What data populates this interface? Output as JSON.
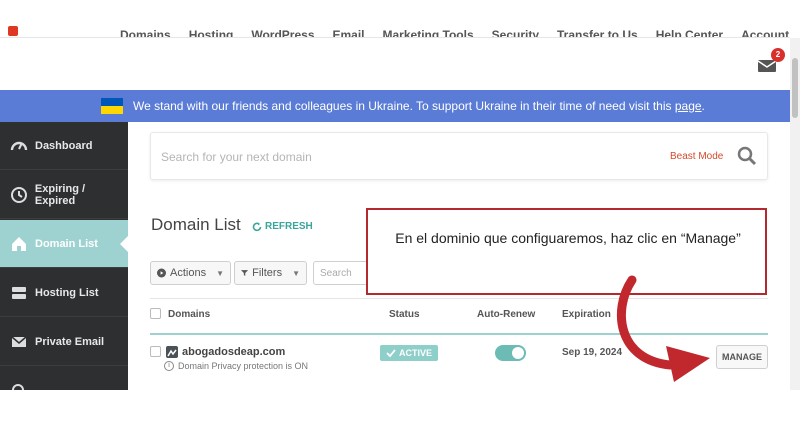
{
  "topnav": {
    "items": [
      "Domains",
      "Hosting",
      "WordPress",
      "Email",
      "Marketing Tools",
      "Security",
      "Transfer to Us",
      "Help Center",
      "Account"
    ]
  },
  "notifications": {
    "count": "2",
    "icon": "mail-icon"
  },
  "banner": {
    "text": "We stand with our friends and colleagues in Ukraine. To support Ukraine in their time of need visit this ",
    "link": "page",
    "suffix": ".",
    "colors": {
      "bg": "#5a7cd6",
      "flag_blue": "#0057b7",
      "flag_yellow": "#ffd700"
    }
  },
  "sidebar": {
    "items": [
      {
        "label": "Dashboard",
        "icon": "gauge-icon"
      },
      {
        "label": "Expiring / Expired",
        "icon": "clock-history-icon"
      },
      {
        "label": "Domain List",
        "icon": "home-icon",
        "active": true
      },
      {
        "label": "Hosting List",
        "icon": "server-icon"
      },
      {
        "label": "Private Email",
        "icon": "envelope-icon"
      }
    ]
  },
  "search": {
    "placeholder": "Search for your next domain",
    "beast_mode": "Beast Mode"
  },
  "domain_list": {
    "title": "Domain List",
    "refresh": "REFRESH",
    "actions_label": "Actions",
    "filters_label": "Filters",
    "search_placeholder": "Search",
    "columns": [
      "Domains",
      "Status",
      "Auto-Renew",
      "Expiration"
    ],
    "rows": [
      {
        "domain": "abogadosdeap.com",
        "privacy_note": "Domain Privacy protection is ON",
        "status": "ACTIVE",
        "auto_renew": true,
        "expiration": "Sep 19, 2024",
        "manage_label": "MANAGE"
      }
    ]
  },
  "callout": {
    "text": "En el dominio que configuaremos, haz clic en “Manage”",
    "border_color": "#b22a2e"
  },
  "accent": "#9ed2d1"
}
